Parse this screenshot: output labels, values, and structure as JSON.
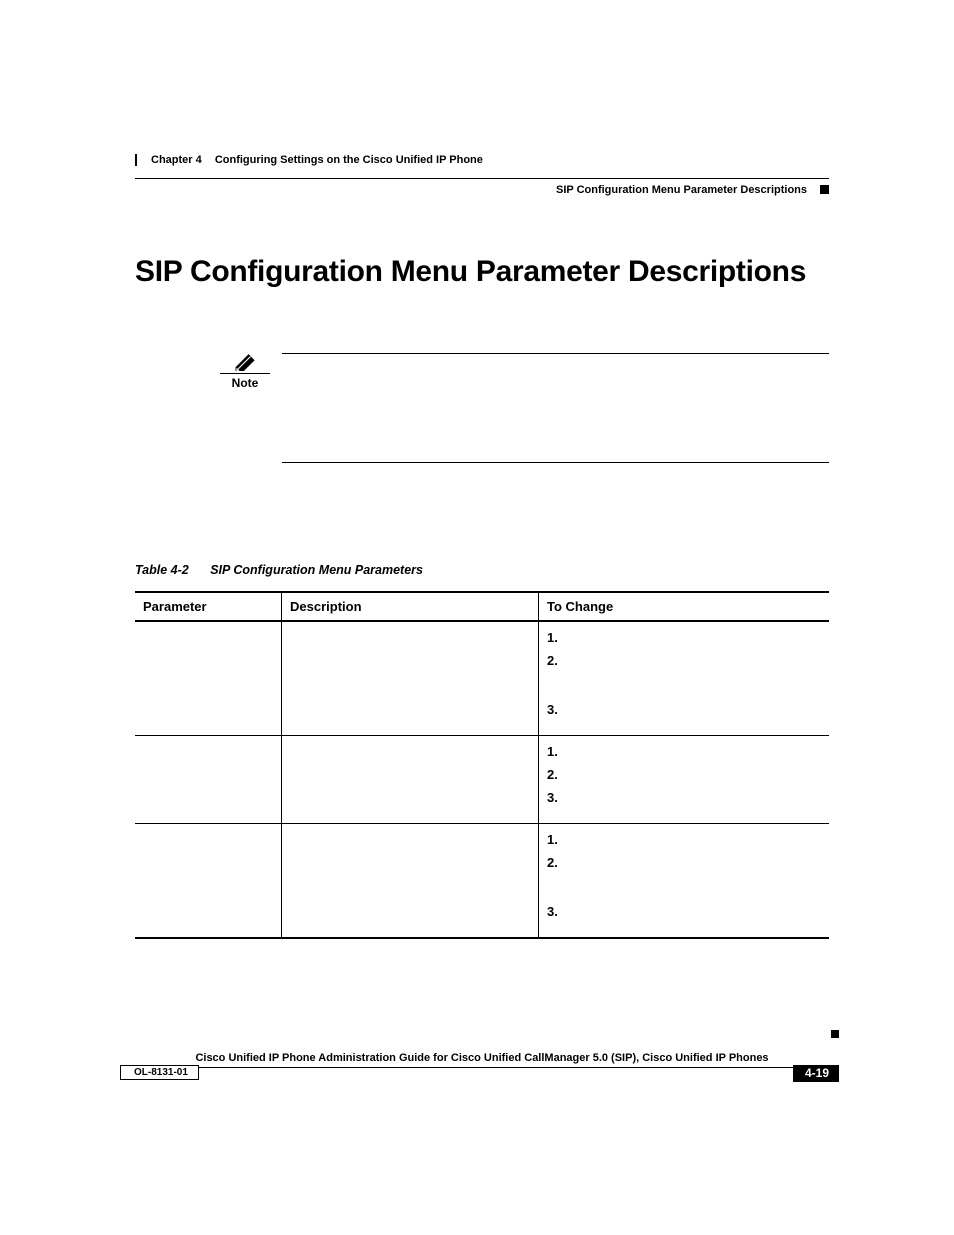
{
  "header": {
    "chapter": "Chapter 4",
    "chapter_title": "Configuring Settings on the Cisco Unified IP Phone",
    "section": "SIP Configuration Menu Parameter Descriptions"
  },
  "title": "SIP Configuration Menu Parameter Descriptions",
  "note": {
    "label": "Note"
  },
  "table": {
    "caption_number": "Table 4-2",
    "caption_title": "SIP Configuration Menu Parameters",
    "headers": {
      "parameter": "Parameter",
      "description": "Description",
      "to_change": "To Change"
    },
    "rows": [
      {
        "steps": [
          "1.",
          "2.",
          "3."
        ],
        "gap_before_last": true
      },
      {
        "steps": [
          "1.",
          "2.",
          "3."
        ],
        "gap_before_last": false
      },
      {
        "steps": [
          "1.",
          "2.",
          "3."
        ],
        "gap_before_last": true
      }
    ]
  },
  "footer": {
    "guide": "Cisco Unified IP Phone Administration Guide for Cisco Unified CallManager 5.0 (SIP), Cisco Unified IP Phones",
    "doc_id": "OL-8131-01",
    "page": "4-19"
  }
}
